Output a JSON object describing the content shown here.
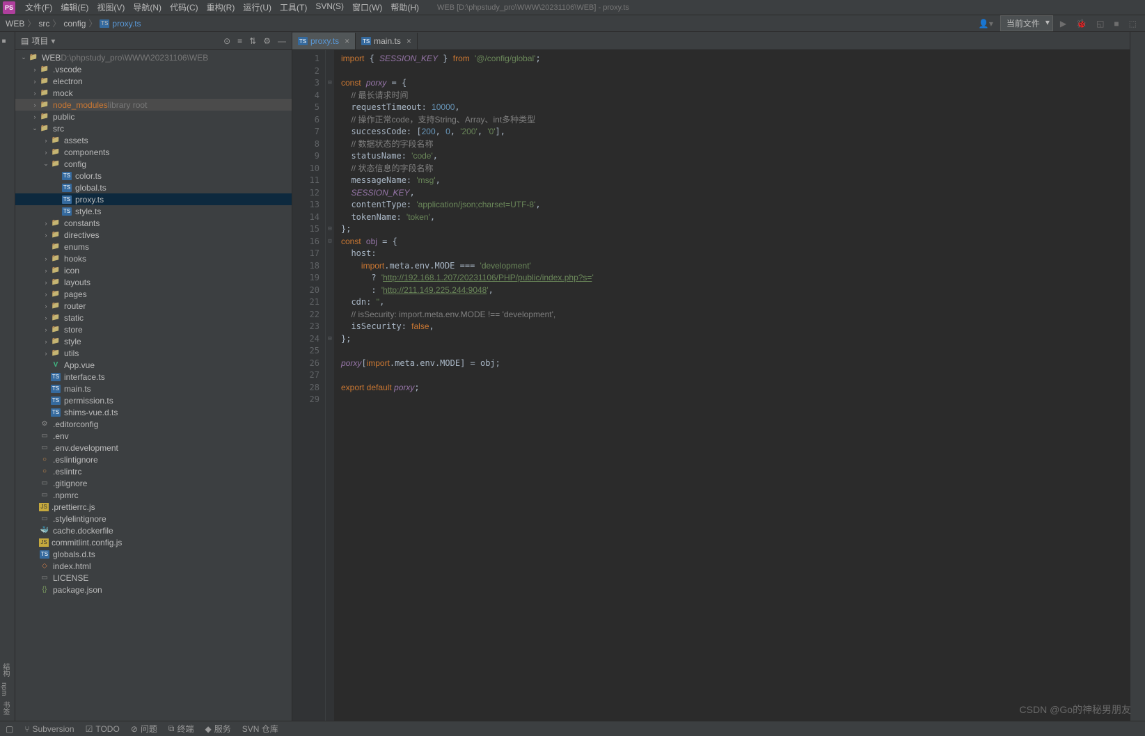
{
  "menubar": {
    "items": [
      "文件(F)",
      "编辑(E)",
      "视图(V)",
      "导航(N)",
      "代码(C)",
      "重构(R)",
      "运行(U)",
      "工具(T)",
      "SVN(S)",
      "窗口(W)",
      "帮助(H)"
    ],
    "title": "WEB [D:\\phpstudy_pro\\WWW\\20231106\\WEB] - proxy.ts"
  },
  "breadcrumbs": {
    "root": "WEB",
    "p1": "src",
    "p2": "config",
    "file": "proxy.ts"
  },
  "run_config": "当前文件",
  "sidebar": {
    "title": "项目",
    "root_name": "WEB",
    "root_path": "D:\\phpstudy_pro\\WWW\\20231106\\WEB",
    "tree": [
      {
        "d": 0,
        "ar": "v",
        "ic": "folder",
        "label": "WEB",
        "extra": "D:\\phpstudy_pro\\WWW\\20231106\\WEB"
      },
      {
        "d": 1,
        "ar": ">",
        "ic": "folder",
        "label": ".vscode"
      },
      {
        "d": 1,
        "ar": ">",
        "ic": "folder",
        "label": "electron"
      },
      {
        "d": 1,
        "ar": ">",
        "ic": "folder",
        "label": "mock"
      },
      {
        "d": 1,
        "ar": ">",
        "ic": "folder",
        "label": "node_modules",
        "extra": "library root",
        "hl": true,
        "orange": true
      },
      {
        "d": 1,
        "ar": ">",
        "ic": "folder",
        "label": "public"
      },
      {
        "d": 1,
        "ar": "v",
        "ic": "folder",
        "label": "src"
      },
      {
        "d": 2,
        "ar": ">",
        "ic": "folder",
        "label": "assets"
      },
      {
        "d": 2,
        "ar": ">",
        "ic": "folder",
        "label": "components"
      },
      {
        "d": 2,
        "ar": "v",
        "ic": "folder",
        "label": "config"
      },
      {
        "d": 3,
        "ar": "",
        "ic": "ts",
        "label": "color.ts"
      },
      {
        "d": 3,
        "ar": "",
        "ic": "ts",
        "label": "global.ts"
      },
      {
        "d": 3,
        "ar": "",
        "ic": "ts",
        "label": "proxy.ts",
        "sel": true
      },
      {
        "d": 3,
        "ar": "",
        "ic": "ts",
        "label": "style.ts"
      },
      {
        "d": 2,
        "ar": ">",
        "ic": "folder",
        "label": "constants"
      },
      {
        "d": 2,
        "ar": ">",
        "ic": "folder",
        "label": "directives"
      },
      {
        "d": 2,
        "ar": "",
        "ic": "folder",
        "label": "enums"
      },
      {
        "d": 2,
        "ar": ">",
        "ic": "folder",
        "label": "hooks"
      },
      {
        "d": 2,
        "ar": ">",
        "ic": "folder",
        "label": "icon"
      },
      {
        "d": 2,
        "ar": ">",
        "ic": "folder",
        "label": "layouts"
      },
      {
        "d": 2,
        "ar": ">",
        "ic": "folder",
        "label": "pages"
      },
      {
        "d": 2,
        "ar": ">",
        "ic": "folder",
        "label": "router"
      },
      {
        "d": 2,
        "ar": ">",
        "ic": "folder",
        "label": "static"
      },
      {
        "d": 2,
        "ar": ">",
        "ic": "folder",
        "label": "store"
      },
      {
        "d": 2,
        "ar": ">",
        "ic": "folder",
        "label": "style"
      },
      {
        "d": 2,
        "ar": ">",
        "ic": "folder",
        "label": "utils"
      },
      {
        "d": 2,
        "ar": "",
        "ic": "vue",
        "label": "App.vue"
      },
      {
        "d": 2,
        "ar": "",
        "ic": "ts",
        "label": "interface.ts"
      },
      {
        "d": 2,
        "ar": "",
        "ic": "ts",
        "label": "main.ts"
      },
      {
        "d": 2,
        "ar": "",
        "ic": "ts",
        "label": "permission.ts"
      },
      {
        "d": 2,
        "ar": "",
        "ic": "ts",
        "label": "shims-vue.d.ts"
      },
      {
        "d": 1,
        "ar": "",
        "ic": "gear",
        "label": ".editorconfig"
      },
      {
        "d": 1,
        "ar": "",
        "ic": "file",
        "label": ".env"
      },
      {
        "d": 1,
        "ar": "",
        "ic": "file",
        "label": ".env.development"
      },
      {
        "d": 1,
        "ar": "",
        "ic": "circle",
        "label": ".eslintignore"
      },
      {
        "d": 1,
        "ar": "",
        "ic": "circle",
        "label": ".eslintrc"
      },
      {
        "d": 1,
        "ar": "",
        "ic": "file",
        "label": ".gitignore"
      },
      {
        "d": 1,
        "ar": "",
        "ic": "file",
        "label": ".npmrc"
      },
      {
        "d": 1,
        "ar": "",
        "ic": "js",
        "label": ".prettierrc.js"
      },
      {
        "d": 1,
        "ar": "",
        "ic": "file",
        "label": ".stylelintignore"
      },
      {
        "d": 1,
        "ar": "",
        "ic": "docker",
        "label": "cache.dockerfile"
      },
      {
        "d": 1,
        "ar": "",
        "ic": "js",
        "label": "commitlint.config.js"
      },
      {
        "d": 1,
        "ar": "",
        "ic": "ts",
        "label": "globals.d.ts"
      },
      {
        "d": 1,
        "ar": "",
        "ic": "html",
        "label": "index.html"
      },
      {
        "d": 1,
        "ar": "",
        "ic": "file",
        "label": "LICENSE"
      },
      {
        "d": 1,
        "ar": "",
        "ic": "json",
        "label": "package.json"
      }
    ]
  },
  "tabs": [
    {
      "name": "proxy.ts",
      "active": true,
      "modified": true
    },
    {
      "name": "main.ts",
      "active": false,
      "modified": false
    }
  ],
  "code_lines": 29,
  "code": {
    "l1": {
      "a": "import",
      "b": "SESSION_KEY",
      "c": "from",
      "d": "'@/config/global'"
    },
    "l3": {
      "a": "const",
      "b": "porxy",
      "c": " = {"
    },
    "l4": "// 最长请求时间",
    "l5": {
      "a": "requestTimeout: ",
      "b": "10000"
    },
    "l6": "// 操作正常code，支持String、Array、int多种类型",
    "l7": {
      "a": "successCode: [",
      "b": "200",
      "c": "0",
      "d": "'200'",
      "e": "'0'"
    },
    "l8": "// 数据状态的字段名称",
    "l9": {
      "a": "statusName: ",
      "b": "'code'"
    },
    "l10": "// 状态信息的字段名称",
    "l11": {
      "a": "messageName: ",
      "b": "'msg'"
    },
    "l12": "SESSION_KEY",
    "l13": {
      "a": "contentType: ",
      "b": "'application/json;charset=UTF-8'"
    },
    "l14": {
      "a": "tokenName: ",
      "b": "'token'"
    },
    "l16": {
      "a": "const",
      "b": "obj",
      "c": " = {"
    },
    "l17": "host:",
    "l18": {
      "a": "import",
      "b": ".meta.env.MODE === ",
      "c": "'development'"
    },
    "l19": {
      "a": "? ",
      "b": "'",
      "c": "http://192.168.1.207/20231106/PHP/public/index.php?s=",
      "d": "'"
    },
    "l20": {
      "a": ": ",
      "b": "'",
      "c": "http://211.149.225.244:9048",
      "d": "'"
    },
    "l21": {
      "a": "cdn: ",
      "b": "''"
    },
    "l22": "// isSecurity: import.meta.env.MODE !== 'development',",
    "l23": {
      "a": "isSecurity: ",
      "b": "false"
    },
    "l26": {
      "a": "porxy",
      "b": "[",
      "c": "import",
      "d": ".meta.env.MODE] = obj;"
    },
    "l28": {
      "a": "export default ",
      "b": "porxy"
    }
  },
  "statusbar": {
    "subversion": "Subversion",
    "todo": "TODO",
    "problems": "问题",
    "terminal": "终端",
    "services": "服务",
    "svn": "SVN 仓库"
  },
  "watermark": "CSDN @Go的神秘男朋友"
}
